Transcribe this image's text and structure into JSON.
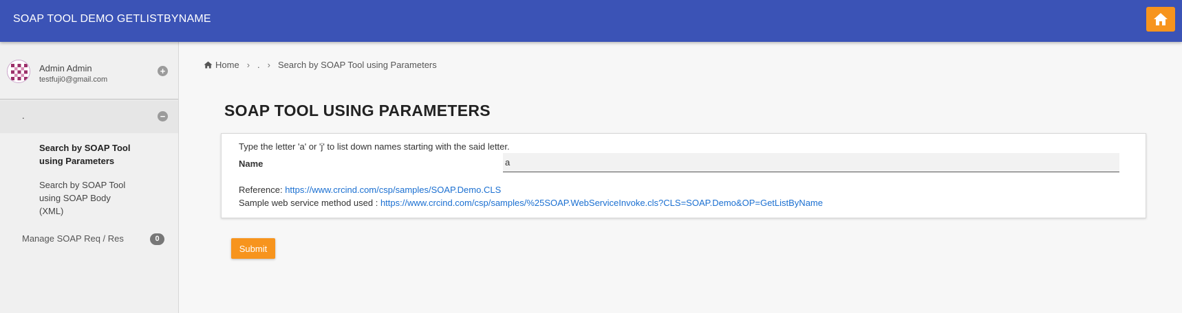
{
  "header": {
    "title": "SOAP TOOL DEMO GETLISTBYNAME",
    "home_icon": "home-icon",
    "accent_color": "#3b53b6",
    "button_color": "#f7941d"
  },
  "sidebar": {
    "user": {
      "name": "Admin Admin",
      "email": "testfuji0@gmail.com",
      "expand_symbol": "+"
    },
    "group": {
      "label": ".",
      "collapse_symbol": "−"
    },
    "items": [
      {
        "label": "Search by SOAP Tool using Parameters",
        "active": true
      },
      {
        "label": "Search by SOAP Tool using SOAP Body (XML)",
        "active": false
      }
    ],
    "manage": {
      "label": "Manage SOAP Req / Res",
      "badge": "0"
    }
  },
  "breadcrumb": {
    "home": "Home",
    "middle": ".",
    "current": "Search by SOAP Tool using Parameters"
  },
  "main": {
    "title": "SOAP TOOL USING PARAMETERS",
    "instructions": "Type the letter 'a' or 'j' to list down names starting with the said letter.",
    "name_label": "Name",
    "name_value": "a",
    "reference_label": "Reference: ",
    "reference_url": "https://www.crcind.com/csp/samples/SOAP.Demo.CLS",
    "sample_label": "Sample web service method used : ",
    "sample_url": "https://www.crcind.com/csp/samples/%25SOAP.WebServiceInvoke.cls?CLS=SOAP.Demo&OP=GetListByName",
    "submit_label": "Submit"
  }
}
